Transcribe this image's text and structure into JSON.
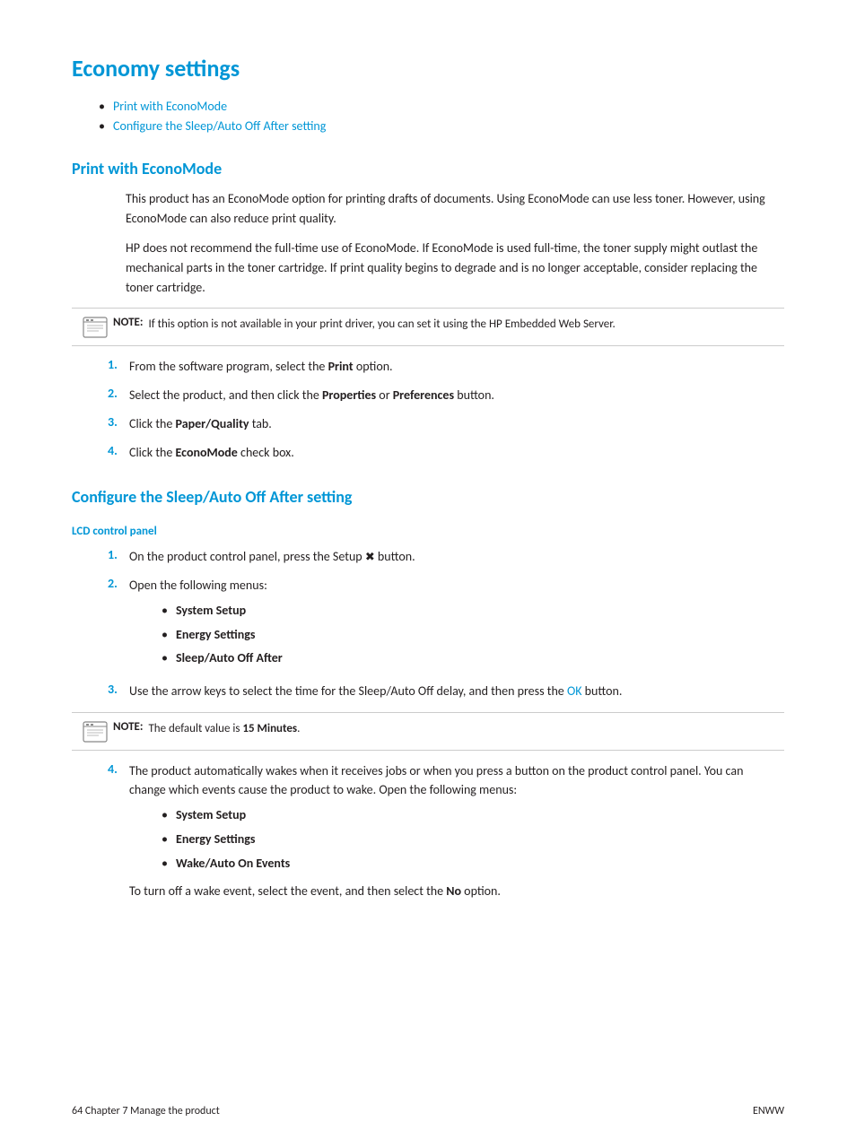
{
  "page": {
    "title": "Economy settings",
    "toc": [
      {
        "label": "Print with EconoMode",
        "anchor": "#econoMode"
      },
      {
        "label": "Configure the Sleep/Auto Off After setting",
        "anchor": "#sleepAuto"
      }
    ]
  },
  "sections": {
    "econoMode": {
      "title": "Print with EconoMode",
      "paragraphs": [
        "This product has an EconoMode option for printing drafts of documents. Using EconoMode can use less toner. However, using EconoMode can also reduce print quality.",
        "HP does not recommend the full-time use of EconoMode. If EconoMode is used full-time, the toner supply might outlast the mechanical parts in the toner cartridge. If print quality begins to degrade and is no longer acceptable, consider replacing the toner cartridge."
      ],
      "note": "If this option is not available in your print driver, you can set it using the HP Embedded Web Server.",
      "steps": [
        {
          "num": "1.",
          "text": "From the software program, select the ",
          "bold": "Print",
          "after": " option."
        },
        {
          "num": "2.",
          "text": "Select the product, and then click the ",
          "bold1": "Properties",
          "mid": " or ",
          "bold2": "Preferences",
          "after": " button."
        },
        {
          "num": "3.",
          "text": "Click the ",
          "bold": "Paper/Quality",
          "after": " tab."
        },
        {
          "num": "4.",
          "text": "Click the ",
          "bold": "EconoMode",
          "after": " check box."
        }
      ]
    },
    "sleepAuto": {
      "title": "Configure the Sleep/Auto Off After setting",
      "subsection": "LCD control panel",
      "steps": [
        {
          "num": "1.",
          "text": "On the product control panel, press the Setup ",
          "icon": "↖",
          "after": " button."
        },
        {
          "num": "2.",
          "text": "Open the following menus:",
          "bullets": [
            "System Setup",
            "Energy Settings",
            "Sleep/Auto Off After"
          ]
        },
        {
          "num": "3.",
          "text": "Use the arrow keys to select the time for the Sleep/Auto Off delay, and then press the ",
          "okLink": "OK",
          "after": " button."
        },
        {
          "num": "4.",
          "text": "The product automatically wakes when it receives jobs or when you press a button on the product control panel. You can change which events cause the product to wake. Open the following menus:",
          "bullets": [
            "System Setup",
            "Energy Settings",
            "Wake/Auto On Events"
          ],
          "trailing": "To turn off a wake event, select the event, and then select the "
        }
      ],
      "note3": "The default value is ",
      "note3Bold": "15 Minutes",
      "note3After": ".",
      "trailingText": "To turn off a wake event, select the event, and then select the ",
      "trailingBold": "No",
      "trailingAfter": " option."
    }
  },
  "footer": {
    "left": "64    Chapter 7   Manage the product",
    "right": "ENWW"
  }
}
